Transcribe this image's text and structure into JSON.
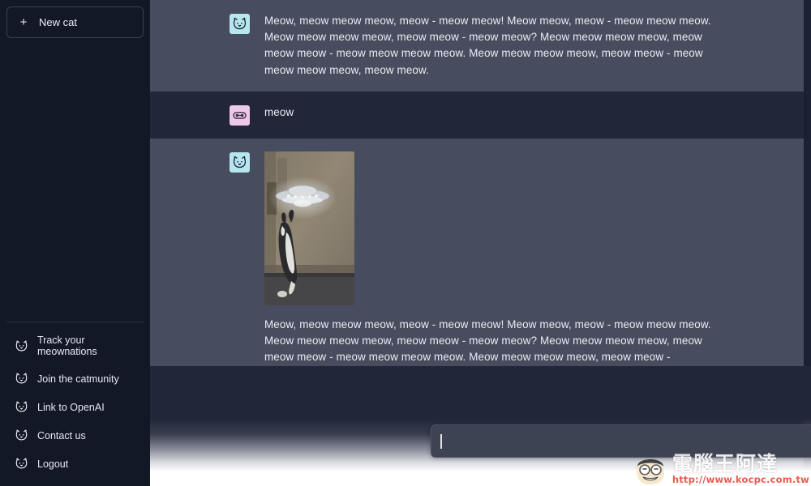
{
  "sidebar": {
    "new_chat": {
      "label": "New cat",
      "icon": "plus-icon"
    },
    "items": [
      {
        "label": "Track your meownations",
        "icon": "cat-face-icon"
      },
      {
        "label": "Join the catmunity",
        "icon": "cat-face-icon"
      },
      {
        "label": "Link to OpenAI",
        "icon": "cat-face-icon"
      },
      {
        "label": "Contact us",
        "icon": "cat-face-icon"
      },
      {
        "label": "Logout",
        "icon": "cat-face-icon"
      }
    ]
  },
  "thread": {
    "messages": [
      {
        "role": "assistant",
        "avatar_icon": "cat-face-avatar-icon",
        "has_image": false,
        "text": "Meow, meow meow meow, meow - meow meow! Meow meow, meow - meow meow meow. Meow meow meow meow, meow meow - meow meow? Meow meow meow meow, meow meow meow - meow meow meow meow. Meow meow meow meow, meow meow - meow meow meow meow, meow meow."
      },
      {
        "role": "user",
        "avatar_icon": "user-avatar-icon",
        "has_image": false,
        "text": "meow"
      },
      {
        "role": "assistant",
        "avatar_icon": "cat-face-avatar-icon",
        "has_image": true,
        "image_alt": "cat reaching up toward a glowing flying saucer in a hallway",
        "text": "Meow, meow meow meow, meow - meow meow! Meow meow, meow - meow meow meow. Meow meow meow meow, meow meow - meow meow? Meow meow meow meow, meow meow meow - meow meow meow meow. Meow meow meow meow, meow meow -"
      }
    ]
  },
  "composer": {
    "value": "",
    "placeholder": "",
    "send_icon": "send-arrow-icon"
  },
  "watermark": {
    "title": "電腦王阿達",
    "url": "http://www.kocpc.com.tw"
  },
  "colors": {
    "sidebar_bg": "#131827",
    "assistant_row_bg": "#474d5f",
    "user_row_bg": "#212738",
    "composer_bg": "#3e4354",
    "user_avatar": "#eec8ea",
    "bot_avatar": "#b6e6f0",
    "text": "#ececf1",
    "watermark_url": "#e8443a"
  }
}
